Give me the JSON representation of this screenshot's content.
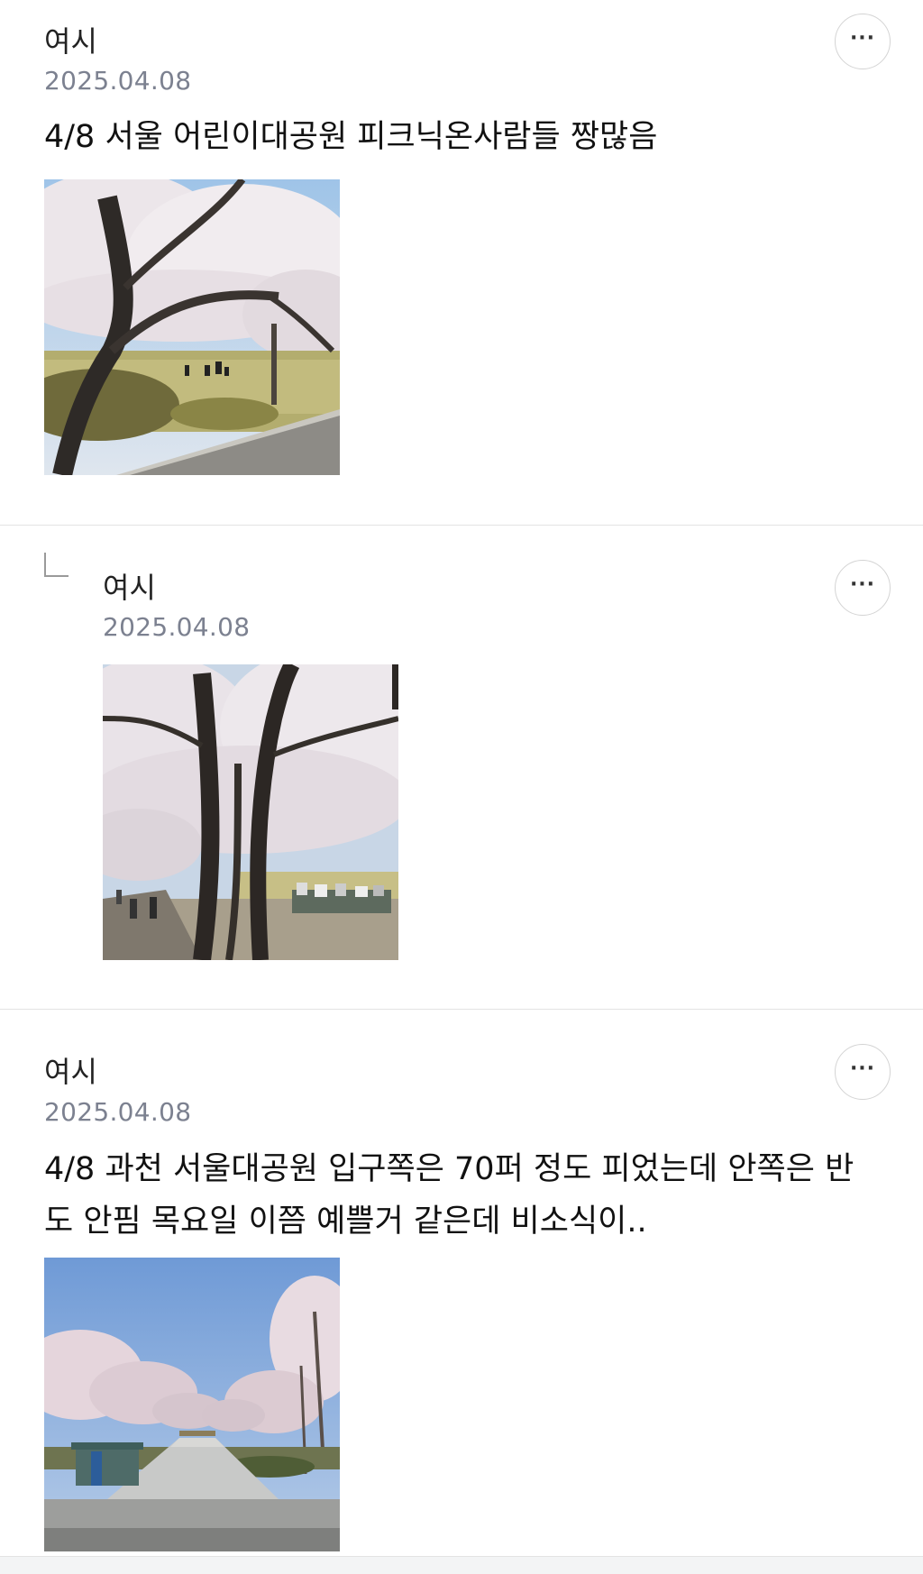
{
  "posts": [
    {
      "author": "여시",
      "date": "2025.04.08",
      "title": "4/8 서울 어린이대공원 피크닉온사람들 짱많음",
      "more_label": "···",
      "image_icon": "photo-cherry-blossom-park-picnic"
    },
    {
      "author": "여시",
      "date": "2025.04.08",
      "is_reply": true,
      "reply_icon": "reply-corner-icon",
      "more_label": "···",
      "image_icon": "photo-cherry-blossom-trees-crowd"
    },
    {
      "author": "여시",
      "date": "2025.04.08",
      "title_line1": "4/8 과천 서울대공원 입구쪽은 70퍼 정도 피었는데 안쪽은 반",
      "title_line2": "도 안핌 목요일 이쯤 예쁠거 같은데 비소식이..",
      "more_label": "···",
      "image_icon": "photo-cherry-blossom-avenue"
    }
  ],
  "colors": {
    "date_gray": "#7c8190",
    "divider": "#e3e3e3",
    "text": "#111111"
  }
}
